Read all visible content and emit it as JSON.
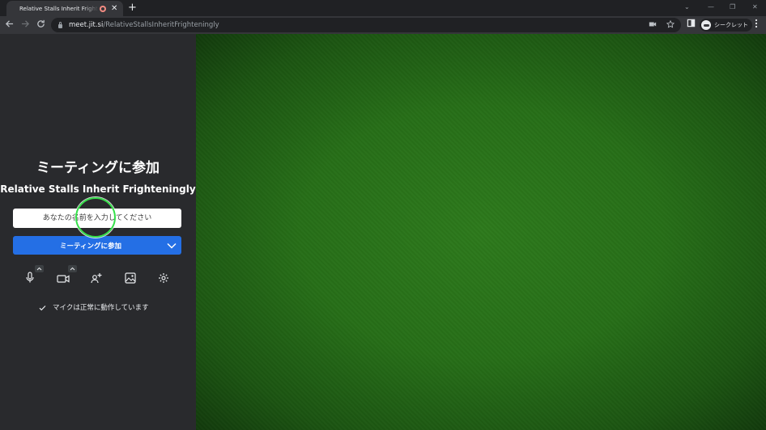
{
  "browser": {
    "tab_title": "Relative Stalls Inherit Frighteningly",
    "tab_close": "✕",
    "new_tab": "+",
    "url_host": "meet.jit.si",
    "url_path": "/RelativeStallsInheritFrighteningly",
    "profile_label": "シークレット",
    "window_controls": [
      "⌄",
      "—",
      "❐",
      "✕"
    ]
  },
  "prejoin": {
    "title": "ミーティングに参加",
    "room_name": "Relative Stalls Inherit Frighteningly",
    "name_placeholder": "あなたの名前を入力してください",
    "name_value": "",
    "join_label": "ミーティングに参加",
    "status_text": "マイクは正常に動作しています"
  },
  "icons": {
    "toolbar": [
      "back-icon",
      "forward-icon",
      "reload-icon",
      "lock-icon",
      "camera-indicator-icon",
      "star-icon",
      "side-panel-icon",
      "incognito-icon",
      "menu-icon"
    ],
    "media": [
      "microphone-icon",
      "camera-icon",
      "invite-icon",
      "background-icon",
      "settings-icon"
    ]
  },
  "colors": {
    "panel": "#292a2d",
    "join_button": "#246fe5",
    "video_preview": "#276f18",
    "highlight_ring": "#36e04b"
  }
}
